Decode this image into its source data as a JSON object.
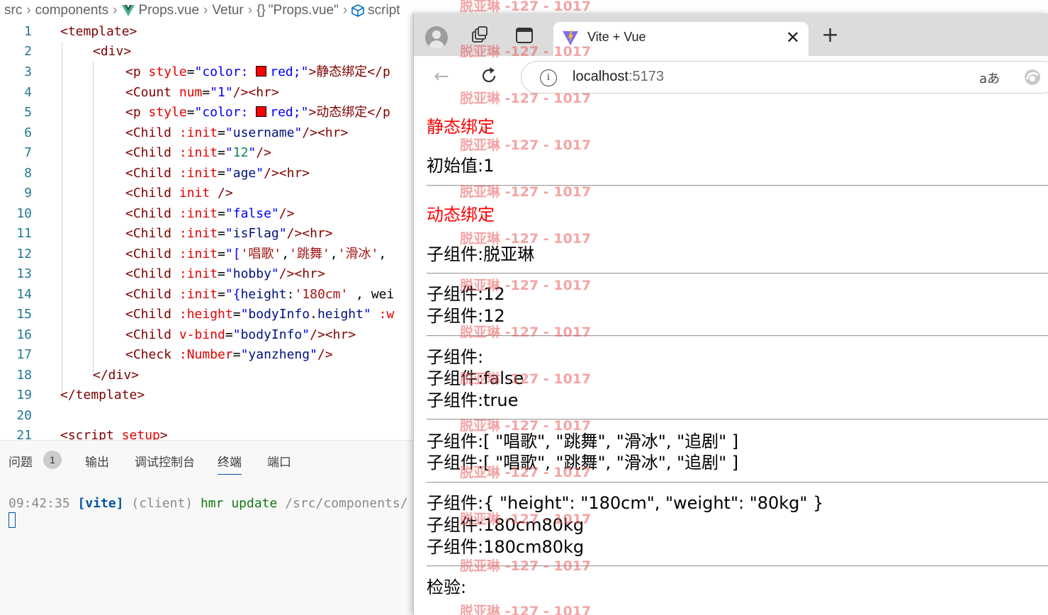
{
  "breadcrumb": {
    "items": [
      "src",
      "components",
      "Props.vue",
      "Vetur",
      "\"Props.vue\"",
      "script"
    ],
    "braces": "{}"
  },
  "editor": {
    "line_numbers": [
      "1",
      "2",
      "3",
      "4",
      "5",
      "6",
      "7",
      "8",
      "9",
      "10",
      "11",
      "12",
      "13",
      "14",
      "15",
      "16",
      "17",
      "18",
      "19",
      "20",
      "21"
    ],
    "lines": [
      [
        "<template>"
      ],
      [
        "<div>"
      ],
      [
        "<p ",
        "style",
        "=",
        "\"color: ",
        "red;\"",
        ">静态绑定</p"
      ],
      [
        "<Count ",
        "num",
        "=",
        "\"1\"",
        "/><hr>"
      ],
      [
        "<p ",
        "style",
        "=",
        "\"color: ",
        "red;\"",
        ">动态绑定</p"
      ],
      [
        "<Child ",
        ":init",
        "=",
        "\"",
        "username",
        "\"",
        "/><hr>"
      ],
      [
        "<Child ",
        ":init",
        "=",
        "\"",
        "12",
        "\"",
        "/>"
      ],
      [
        "<Child ",
        ":init",
        "=",
        "\"",
        "age",
        "\"",
        "/><hr>"
      ],
      [
        "<Child ",
        "init",
        " />"
      ],
      [
        "<Child ",
        ":init",
        "=",
        "\"",
        "false",
        "\"",
        "/>"
      ],
      [
        "<Child ",
        ":init",
        "=",
        "\"",
        "isFlag",
        "\"",
        "/><hr>"
      ],
      [
        "<Child ",
        ":init",
        "=",
        "\"[",
        "'唱歌'",
        ",",
        "'跳舞'",
        ",",
        "'滑冰'",
        ","
      ],
      [
        "<Child ",
        ":init",
        "=",
        "\"",
        "hobby",
        "\"",
        "/><hr>"
      ],
      [
        "<Child ",
        ":init",
        "=",
        "\"{",
        "height",
        ":",
        "'180cm'",
        " , wei"
      ],
      [
        "<Child ",
        ":height",
        "=",
        "\"",
        "bodyInfo",
        ".",
        "height",
        "\"",
        " :w"
      ],
      [
        "<Child ",
        "v-bind",
        "=",
        "\"",
        "bodyInfo",
        "\"",
        "/><hr>"
      ],
      [
        "<Check ",
        ":Number",
        "=",
        "\"",
        "yanzheng",
        "\"",
        "/>"
      ],
      [
        "</div>"
      ],
      [
        "</template>"
      ],
      [
        ""
      ],
      [
        "<script ",
        "setup",
        ">"
      ]
    ]
  },
  "panel": {
    "tabs": [
      "问题",
      "输出",
      "调试控制台",
      "终端",
      "端口"
    ],
    "problems_count": "1",
    "active_tab": "终端",
    "terminal": {
      "time": "09:42:35",
      "tag": "[vite]",
      "client": "(client)",
      "hmr": "hmr update",
      "path": "/src/components/"
    }
  },
  "browser": {
    "tab_title": "Vite + Vue",
    "close_glyph": "✕",
    "new_tab_glyph": "+",
    "url_host": "localhost",
    "url_port": ":5173",
    "translate_glyph": "aあ"
  },
  "page": {
    "static_heading": "静态绑定",
    "initial_value": "初始值:1",
    "dynamic_heading": "动态绑定",
    "child_username": "子组件:脱亚琳",
    "child_12_a": "子组件:12",
    "child_12_b": "子组件:12",
    "child_empty": "子组件:",
    "child_false": "子组件:false",
    "child_true": "子组件:true",
    "child_array_a": "子组件:[ \"唱歌\", \"跳舞\", \"滑冰\", \"追剧\" ]",
    "child_array_b": "子组件:[ \"唱歌\", \"跳舞\", \"滑冰\", \"追剧\" ]",
    "child_object": "子组件:{ \"height\": \"180cm\", \"weight\": \"80kg\" }",
    "child_body_a": "子组件:180cm80kg",
    "child_body_b": "子组件:180cm80kg",
    "check_label": "检验:"
  },
  "watermark": "脱亚琳 -127 - 1017",
  "colors": {
    "accent": "#005fb8",
    "red_text": "#ff0000",
    "watermark": "#eb5a5a"
  }
}
